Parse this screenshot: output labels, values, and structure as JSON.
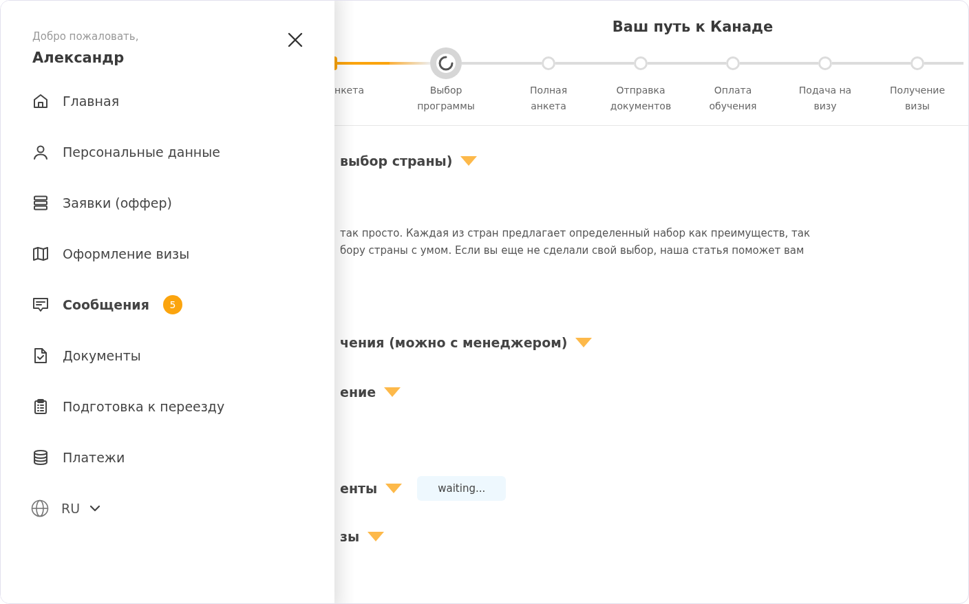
{
  "drawer": {
    "greeting": "Добро пожаловать,",
    "user_name": "Александр",
    "menu": [
      {
        "label": "Главная",
        "kind": "home",
        "unread": false
      },
      {
        "label": "Персональные данные",
        "kind": "person",
        "unread": false
      },
      {
        "label": "Заявки (оффер)",
        "kind": "stack",
        "unread": false
      },
      {
        "label": "Оформление визы",
        "kind": "map",
        "unread": false
      },
      {
        "label": "Сообщения",
        "kind": "message",
        "unread": true,
        "badge": "5"
      },
      {
        "label": "Документы",
        "kind": "document",
        "unread": false
      },
      {
        "label": "Подготовка к переезду",
        "kind": "clipboard",
        "unread": false
      },
      {
        "label": "Платежи",
        "kind": "coins",
        "unread": false
      }
    ],
    "language": "RU"
  },
  "journey": {
    "title": "Ваш путь к Канаде",
    "steps": [
      {
        "label": "нкета",
        "completed": true,
        "selected": false
      },
      {
        "label": "Выбор программы",
        "completed": false,
        "selected": true
      },
      {
        "label": "Полная анкета",
        "completed": false,
        "selected": false
      },
      {
        "label": "Отправка документов",
        "completed": false,
        "selected": false
      },
      {
        "label": "Оплата обучения",
        "completed": false,
        "selected": false
      },
      {
        "label": "Подача на визу",
        "completed": false,
        "selected": false
      },
      {
        "label": "Получение визы",
        "completed": false,
        "selected": false
      }
    ]
  },
  "sections": [
    {
      "title": "выбор страны)",
      "body_lines": [
        "так просто. Каждая из стран предлагает определенный набор как преимуществ, так",
        "бору страны с умом. Если вы еще не сделали свой выбор, наша статья поможет вам"
      ]
    },
    {
      "title": "чения (можно с менеджером)"
    },
    {
      "title": "ение"
    },
    {
      "title": "енты",
      "status": "waiting..."
    },
    {
      "title": "зы"
    }
  ]
}
